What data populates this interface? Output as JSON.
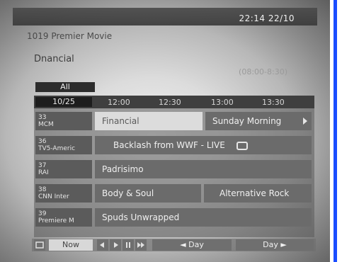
{
  "header": {
    "clock": "22:14",
    "date": "22/10"
  },
  "info": {
    "channel_title": "1019 Premier Movie",
    "program_name": "Dnancial",
    "time_range": "(08:00-8:30)"
  },
  "filter": {
    "label": "All"
  },
  "grid": {
    "date": "10/25",
    "times": [
      "12:00",
      "12:30",
      "13:00",
      "13:30"
    ],
    "rows": [
      {
        "channel": [
          "33",
          "MCM"
        ],
        "programs": [
          {
            "title": "Financial",
            "selected": true
          },
          {
            "title": "Sunday Morning",
            "selected": false
          }
        ]
      },
      {
        "channel": [
          "36",
          "TV5-Americ"
        ],
        "programs": [
          {
            "title": "Backlash from WWF - LIVE",
            "selected": false
          }
        ]
      },
      {
        "channel": [
          "37",
          "RAI"
        ],
        "programs": [
          {
            "title": "Padrisimo",
            "selected": false
          }
        ]
      },
      {
        "channel": [
          "38",
          "CNN Inter"
        ],
        "programs": [
          {
            "title": "Body & Soul",
            "selected": false
          },
          {
            "title": "Alternative Rock",
            "selected": false
          }
        ]
      },
      {
        "channel": [
          "39",
          "Premiere M"
        ],
        "programs": [
          {
            "title": "Spuds Unwrapped",
            "selected": false
          }
        ]
      }
    ]
  },
  "footer": {
    "now_label": "Now",
    "prev_day_label": "◄ Day",
    "next_day_label": "Day ►",
    "transport_icons": [
      "rewind-icon",
      "play-icon",
      "pause-icon",
      "fast-forward-icon"
    ]
  }
}
